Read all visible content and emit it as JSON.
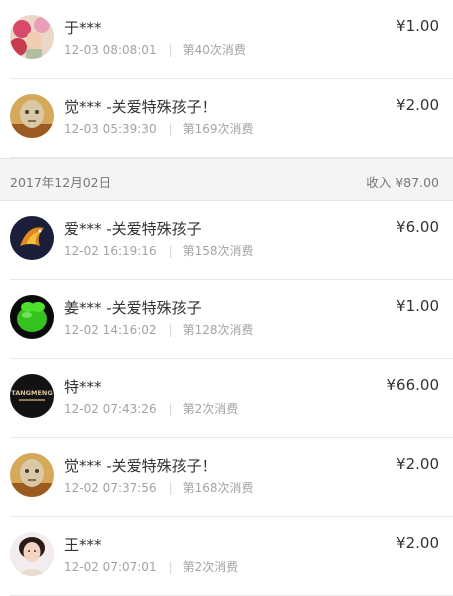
{
  "records_before": [
    {
      "name": "于***",
      "time": "12-03 08:08:01",
      "count": "第40次消费",
      "amount": "¥1.00",
      "avatar": "avatar-red-flowers"
    },
    {
      "name": "觉*** -关爱特殊孩子！",
      "time": "12-03 05:39:30",
      "count": "第169次消费",
      "amount": "¥2.00",
      "avatar": "avatar-monk-face"
    }
  ],
  "group": {
    "date": "2017年12月02日",
    "income": "收入 ¥87.00"
  },
  "records_after": [
    {
      "name": "爱*** -关爱特殊孩子",
      "time": "12-02 16:19:16",
      "count": "第158次消费",
      "amount": "¥6.00",
      "avatar": "avatar-fire-fish"
    },
    {
      "name": "姜*** -关爱特殊孩子",
      "time": "12-02 14:16:02",
      "count": "第128次消费",
      "amount": "¥1.00",
      "avatar": "avatar-green-gift"
    },
    {
      "name": "特***",
      "time": "12-02 07:43:26",
      "count": "第2次消费",
      "amount": "¥66.00",
      "avatar": "avatar-black-logo",
      "logo_text": "TANGMENG"
    },
    {
      "name": "觉*** -关爱特殊孩子！",
      "time": "12-02 07:37:56",
      "count": "第168次消费",
      "amount": "¥2.00",
      "avatar": "avatar-monk-face"
    },
    {
      "name": "王***",
      "time": "12-02 07:07:01",
      "count": "第2次消费",
      "amount": "¥2.00",
      "avatar": "avatar-woman-portrait"
    }
  ]
}
